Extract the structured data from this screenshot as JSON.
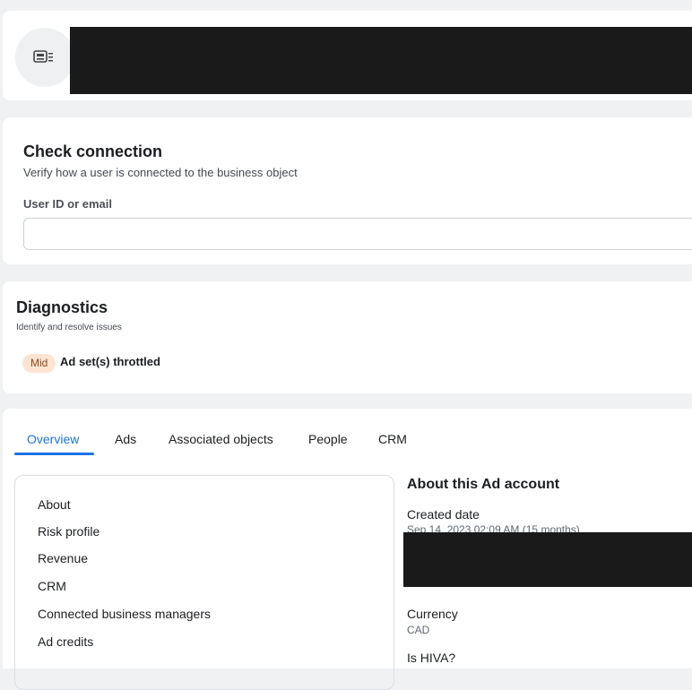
{
  "header": {
    "icon": "business-card-icon"
  },
  "check_connection": {
    "title": "Check connection",
    "subtitle": "Verify how a user is connected to the business object",
    "field_label": "User ID or email",
    "field_value": ""
  },
  "diagnostics": {
    "title": "Diagnostics",
    "subtitle": "Identify and resolve issues",
    "issues": [
      {
        "severity": "Mid",
        "text": "Ad set(s) throttled"
      }
    ]
  },
  "tabs": [
    "Overview",
    "Ads",
    "Associated objects",
    "People",
    "CRM"
  ],
  "active_tab": "Overview",
  "overview_nav": [
    "About",
    "Risk profile",
    "Revenue",
    "CRM",
    "Connected business managers",
    "Ad credits"
  ],
  "about": {
    "title": "About this Ad account",
    "created_label": "Created date",
    "created_value": "Sep 14, 2023 02:09 AM (15 months)",
    "currency_label": "Currency",
    "currency_value": "CAD",
    "hiva_label": "Is HIVA?"
  },
  "colors": {
    "accent": "#1b74e4",
    "badge_bg": "#fde4d2",
    "redaction": "#1a1a1a"
  }
}
